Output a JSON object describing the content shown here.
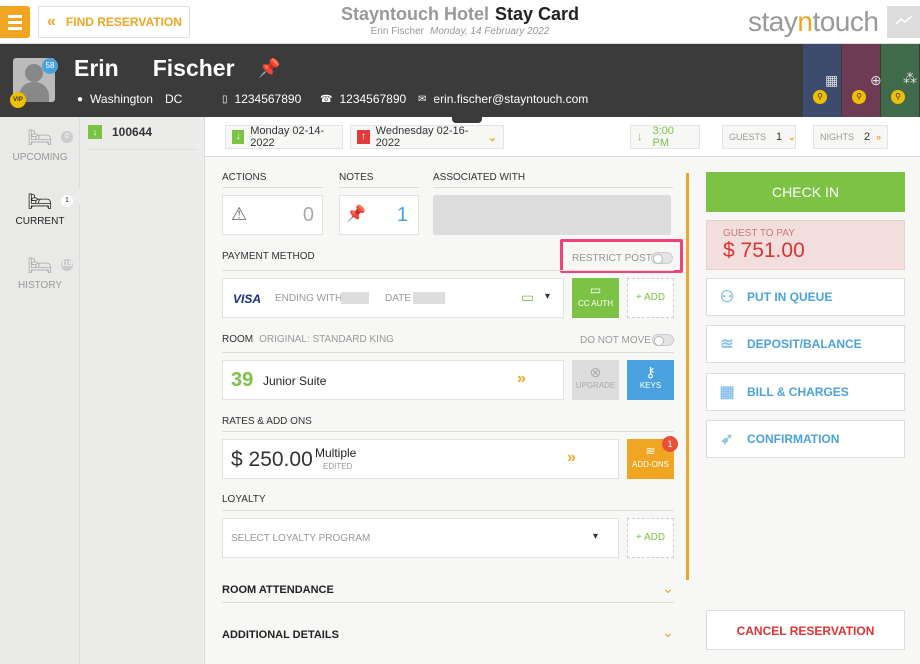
{
  "header": {
    "find_label": "FIND RESERVATION",
    "hotel_name": "Stayntouch Hotel",
    "page_title": "Stay Card",
    "guest": "Erin Fischer",
    "date": "Monday, 14 February 2022",
    "logo_a": "stay",
    "logo_b": "n",
    "logo_c": "touch"
  },
  "guest": {
    "first_name": "Erin",
    "last_name": "Fischer",
    "points_badge": "58",
    "vip": "VIP",
    "city": "Washington",
    "state": "DC",
    "mobile": "1234567890",
    "phone": "1234567890",
    "email": "erin.fischer@stayntouch.com"
  },
  "sidebar": {
    "items": [
      {
        "label": "UPCOMING",
        "count": "0"
      },
      {
        "label": "CURRENT",
        "count": "1"
      },
      {
        "label": "HISTORY",
        "count": "119"
      }
    ]
  },
  "reservation": {
    "number": "100644"
  },
  "dates": {
    "arrival": "Monday 02-14-2022",
    "departure": "Wednesday 02-16-2022",
    "time": "3:00 PM",
    "guests_label": "GUESTS",
    "guests": "1",
    "nights_label": "NIGHTS",
    "nights": "2"
  },
  "sections": {
    "actions_label": "ACTIONS",
    "actions_count": "0",
    "notes_label": "NOTES",
    "notes_count": "1",
    "associated_label": "ASSOCIATED WITH",
    "payment_label": "PAYMENT METHOD",
    "restrict_post": "RESTRICT POST",
    "card_brand": "VISA",
    "ending_with": "ENDING WITH",
    "date_label": "DATE",
    "cc_auth": "CC AUTH",
    "add_label": "+ ADD",
    "room_label": "ROOM",
    "room_original": "ORIGINAL: STANDARD KING",
    "do_not_move": "DO NOT MOVE",
    "room_number": "39",
    "room_type": "Junior Suite",
    "upgrade": "UPGRADE",
    "keys": "KEYS",
    "rates_label": "RATES & ADD ONS",
    "rate": "$ 250.00",
    "rate_name": "Multiple",
    "rate_status": "EDITED",
    "addons": "ADD-ONS",
    "addons_count": "1",
    "loyalty_label": "LOYALTY",
    "loyalty_placeholder": "SELECT LOYALTY PROGRAM",
    "room_attendance": "ROOM ATTENDANCE",
    "additional_details": "ADDITIONAL DETAILS"
  },
  "right": {
    "check_in": "CHECK IN",
    "guest_to_pay_label": "GUEST TO PAY",
    "guest_to_pay": "$ 751.00",
    "put_in_queue": "PUT IN QUEUE",
    "deposit": "DEPOSIT/BALANCE",
    "bill": "BILL & CHARGES",
    "confirmation": "CONFIRMATION",
    "cancel": "CANCEL RESERVATION"
  },
  "colors": {
    "accent": "#f0a623",
    "green": "#7cc245",
    "blue": "#4aa3df",
    "red": "#d33333",
    "highlight": "#f0417a"
  }
}
